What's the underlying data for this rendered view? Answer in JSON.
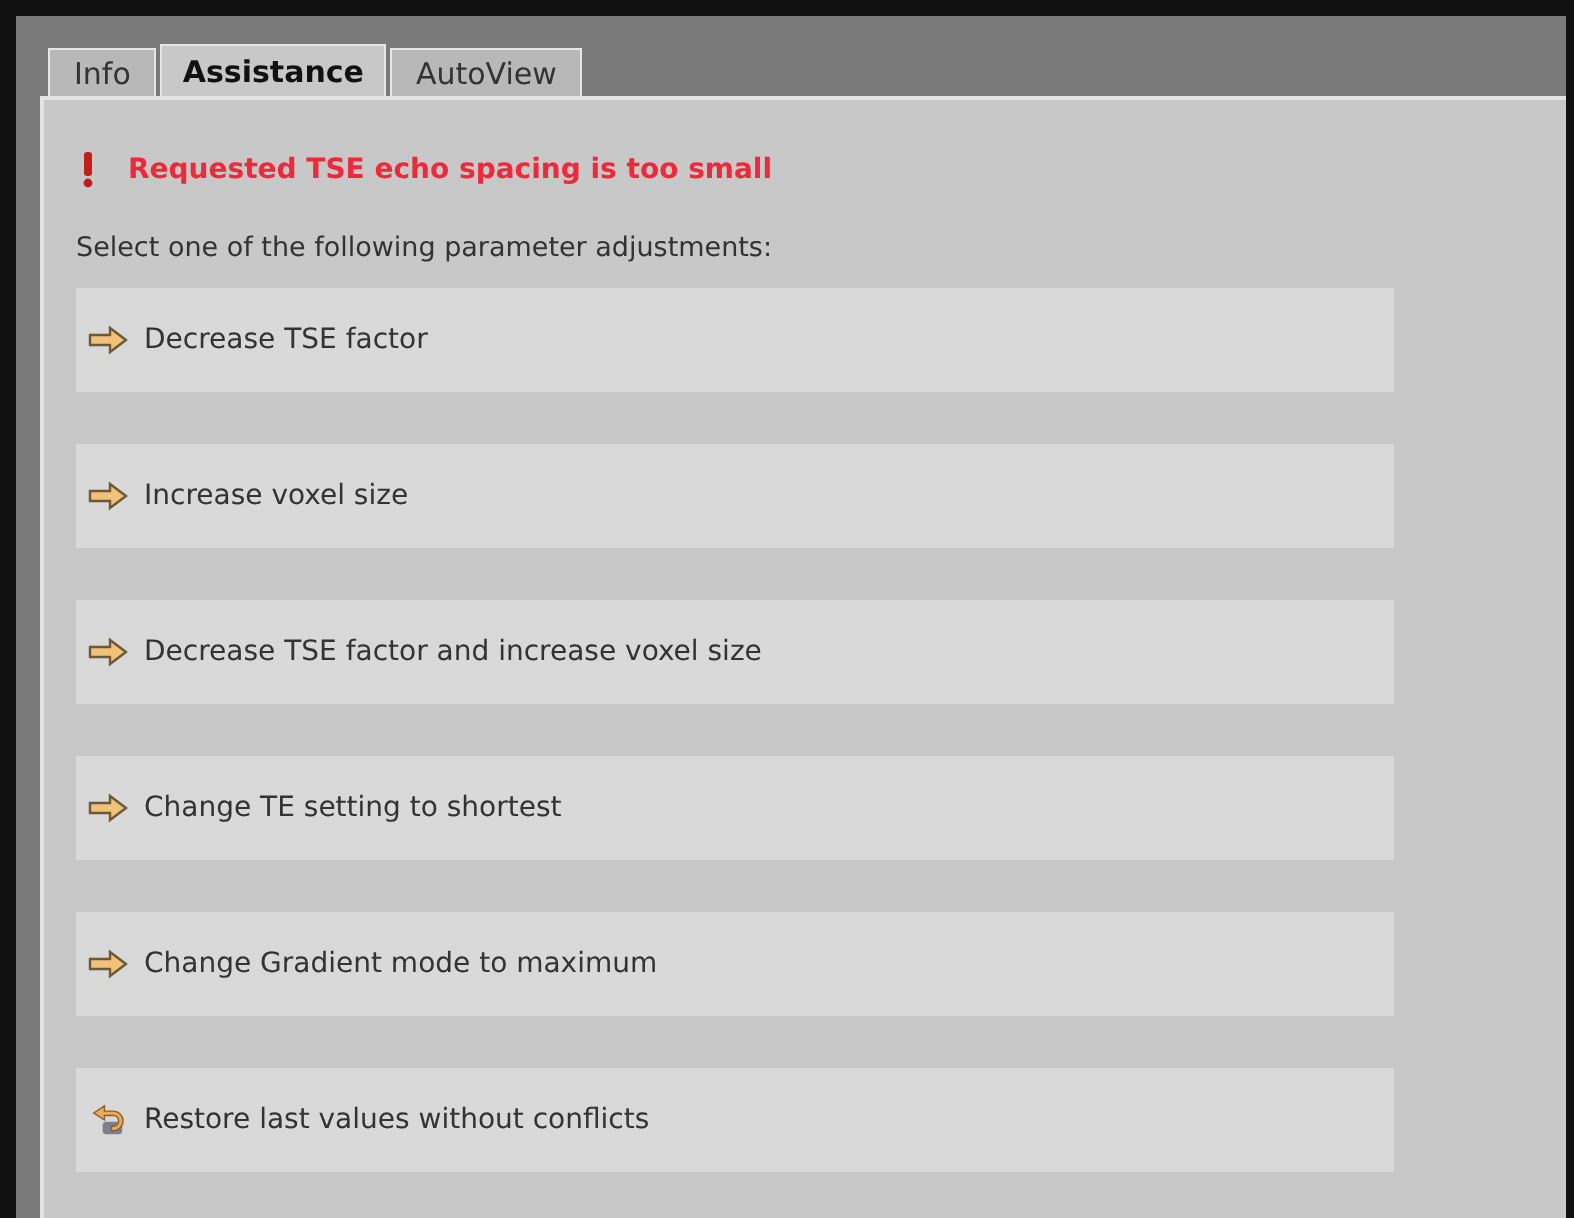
{
  "tabs": [
    {
      "label": "Info",
      "selected": false
    },
    {
      "label": "Assistance",
      "selected": true
    },
    {
      "label": "AutoView",
      "selected": false
    }
  ],
  "error": {
    "message": "Requested TSE echo spacing is too small"
  },
  "prompt": "Select one of the following parameter adjustments:",
  "options": [
    {
      "kind": "arrow",
      "label": "Decrease TSE factor"
    },
    {
      "kind": "arrow",
      "label": "Increase voxel size"
    },
    {
      "kind": "arrow",
      "label": "Decrease TSE factor and increase voxel size"
    },
    {
      "kind": "arrow",
      "label": "Change TE setting to shortest"
    },
    {
      "kind": "arrow",
      "label": "Change Gradient mode to maximum"
    },
    {
      "kind": "restore",
      "label": "Restore last values without conflicts"
    }
  ]
}
